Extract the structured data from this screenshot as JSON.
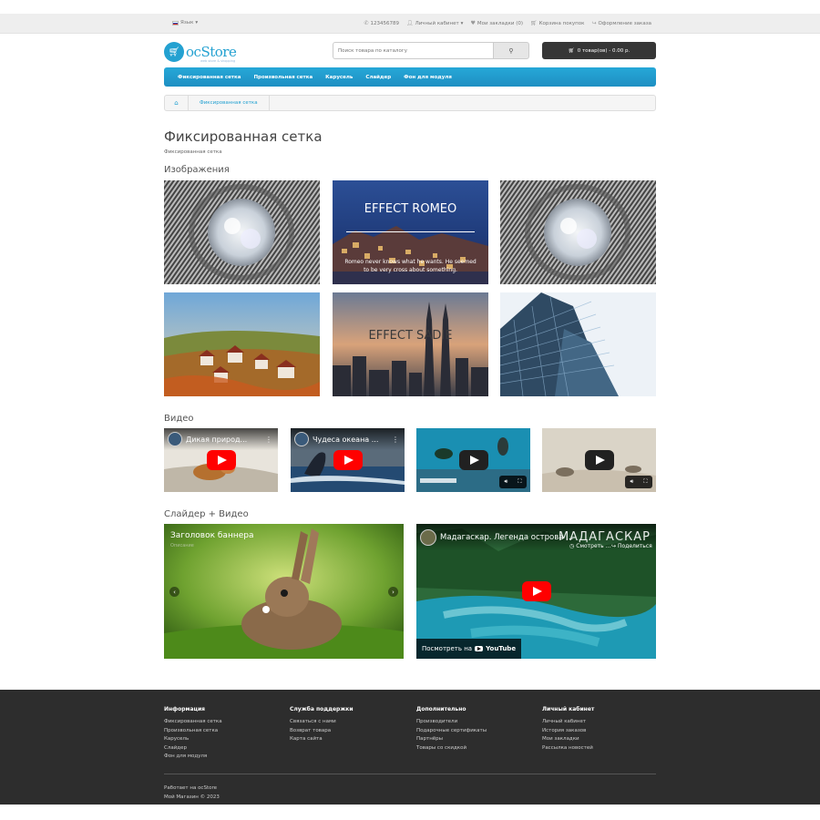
{
  "topbar": {
    "lang": "Язык",
    "phone": "123456789",
    "account": "Личный кабинет",
    "wishlist": "Мои закладки (0)",
    "cart": "Корзина покупок",
    "checkout": "Оформление заказа"
  },
  "header": {
    "logo_prefix": "oc",
    "logo_main": "Store",
    "logo_tagline": "web store & shopping",
    "search_placeholder": "Поиск товара по каталогу",
    "cart_summary": "0 товар(ов) - 0.00 р."
  },
  "menu": [
    "Фиксированная сетка",
    "Произвольная сетка",
    "Карусель",
    "Слайдер",
    "Фон для модуля"
  ],
  "breadcrumb": {
    "current": "Фиксированная сетка"
  },
  "page": {
    "title": "Фиксированная сетка",
    "subtitle": "Фиксированная сетка",
    "section_images": "Изображения",
    "section_video": "Видео",
    "section_slider": "Слайдер + Видео"
  },
  "images": {
    "romeo_title": "EFFECT ROMEO",
    "romeo_text1": "Romeo never knows what he wants. He seemed",
    "romeo_text2": "to be very cross about something.",
    "sadie_title": "EFFECT SADIE"
  },
  "videos": [
    {
      "title": "Дикая природ..."
    },
    {
      "title": "Чудеса океана ..."
    },
    {
      "title": ""
    },
    {
      "title": ""
    }
  ],
  "slider": {
    "banner_title": "Заголовок баннера",
    "banner_sub": "Описание"
  },
  "big_video": {
    "title": "Мадагаскар. Легенда острова ...",
    "watch_later": "Смотреть ...",
    "share": "Поделиться",
    "watch_on": "Посмотреть на",
    "youtube": "YouTube",
    "overlay_text": "МАДАГАСКАР"
  },
  "footer": {
    "cols": [
      {
        "title": "Информация",
        "links": [
          "Фиксированная сетка",
          "Произвольная сетка",
          "Карусель",
          "Слайдер",
          "Фон для модуля"
        ]
      },
      {
        "title": "Служба поддержки",
        "links": [
          "Связаться с нами",
          "Возврат товара",
          "Карта сайта"
        ]
      },
      {
        "title": "Дополнительно",
        "links": [
          "Производители",
          "Подарочные сертификаты",
          "Партнёры",
          "Товары со скидкой"
        ]
      },
      {
        "title": "Личный кабинет",
        "links": [
          "Личный кабинет",
          "История заказов",
          "Мои закладки",
          "Рассылка новостей"
        ]
      }
    ],
    "powered": "Работает на ocStore",
    "copyright": "Мой Магазин © 2023"
  },
  "colors": {
    "accent": "#23a1d1",
    "footer_bg": "#2d2d2d",
    "youtube_red": "#ff0000"
  }
}
